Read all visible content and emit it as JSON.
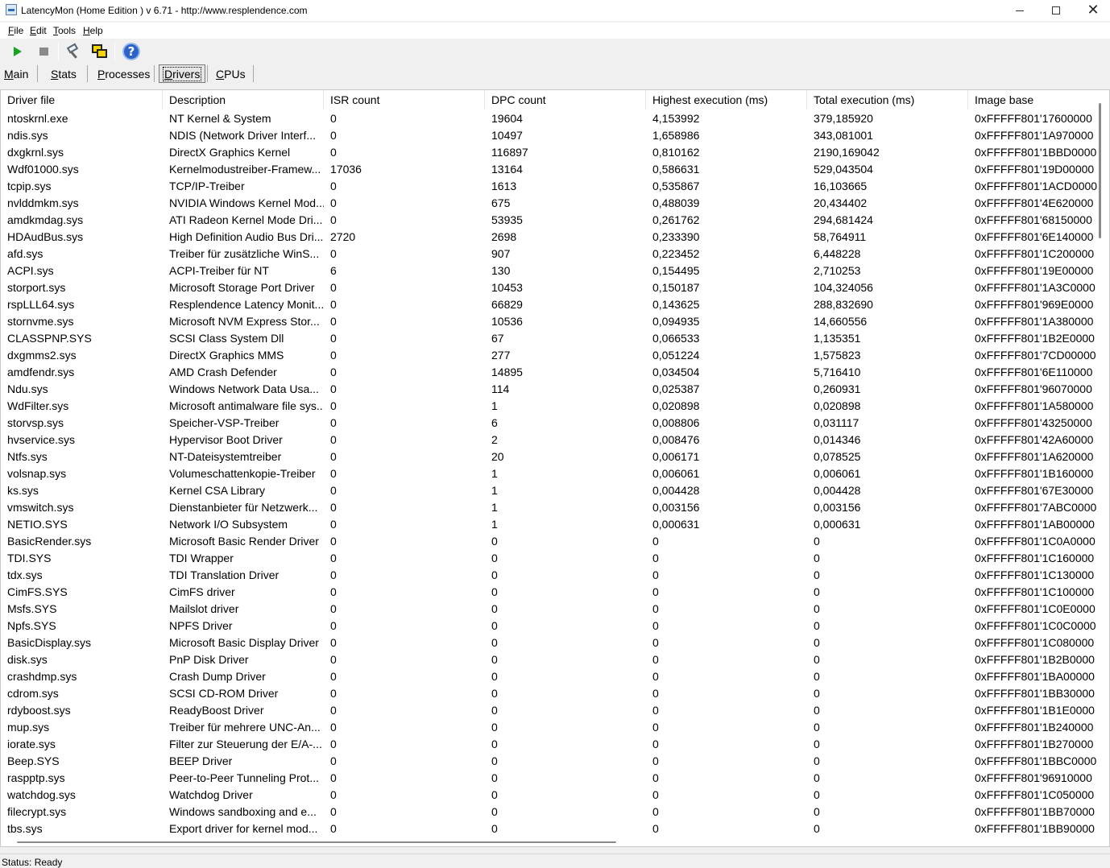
{
  "window": {
    "title": "LatencyMon  (Home Edition )  v 6.71 - http://www.resplendence.com"
  },
  "menu": [
    {
      "ul": "F",
      "rest": "ile"
    },
    {
      "ul": "E",
      "rest": "dit"
    },
    {
      "ul": "T",
      "rest": "ools"
    },
    {
      "ul": "H",
      "rest": "elp"
    }
  ],
  "toolbar": {
    "icons": [
      "play-icon",
      "stop-icon",
      "tools-icon",
      "windows-icon",
      "help-icon"
    ],
    "colors": {
      "play": "#17a31d",
      "help": "#2c63c8",
      "windows": "#f5d500"
    }
  },
  "tabs": [
    {
      "ul": "M",
      "rest": "ain"
    },
    {
      "ul": "S",
      "rest": "tats"
    },
    {
      "ul": "P",
      "rest": "rocesses"
    },
    {
      "ul": "D",
      "rest": "rivers"
    },
    {
      "ul": "C",
      "rest": "PUs"
    }
  ],
  "active_tab": "Drivers",
  "table": {
    "columns": [
      "Driver file",
      "Description",
      "ISR count",
      "DPC count",
      "Highest execution (ms)",
      "Total execution (ms)",
      "Image base"
    ],
    "rows": [
      [
        "ntoskrnl.exe",
        "NT Kernel & System",
        "0",
        "19604",
        "4,153992",
        "379,185920",
        "0xFFFFF801'17600000"
      ],
      [
        "ndis.sys",
        "NDIS (Network Driver Interf...",
        "0",
        "10497",
        "1,658986",
        "343,081001",
        "0xFFFFF801'1A970000"
      ],
      [
        "dxgkrnl.sys",
        "DirectX Graphics Kernel",
        "0",
        "116897",
        "0,810162",
        "2190,169042",
        "0xFFFFF801'1BBD0000"
      ],
      [
        "Wdf01000.sys",
        "Kernelmodustreiber-Framew...",
        "17036",
        "13164",
        "0,586631",
        "529,043504",
        "0xFFFFF801'19D00000"
      ],
      [
        "tcpip.sys",
        "TCP/IP-Treiber",
        "0",
        "1613",
        "0,535867",
        "16,103665",
        "0xFFFFF801'1ACD0000"
      ],
      [
        "nvlddmkm.sys",
        "NVIDIA Windows Kernel Mod...",
        "0",
        "675",
        "0,488039",
        "20,434402",
        "0xFFFFF801'4E620000"
      ],
      [
        "amdkmdag.sys",
        "ATI Radeon Kernel Mode Dri...",
        "0",
        "53935",
        "0,261762",
        "294,681424",
        "0xFFFFF801'68150000"
      ],
      [
        "HDAudBus.sys",
        "High Definition Audio Bus Dri...",
        "2720",
        "2698",
        "0,233390",
        "58,764911",
        "0xFFFFF801'6E140000"
      ],
      [
        "afd.sys",
        "Treiber für zusätzliche WinS...",
        "0",
        "907",
        "0,223452",
        "6,448228",
        "0xFFFFF801'1C200000"
      ],
      [
        "ACPI.sys",
        "ACPI-Treiber für NT",
        "6",
        "130",
        "0,154495",
        "2,710253",
        "0xFFFFF801'19E00000"
      ],
      [
        "storport.sys",
        "Microsoft Storage Port Driver",
        "0",
        "10453",
        "0,150187",
        "104,324056",
        "0xFFFFF801'1A3C0000"
      ],
      [
        "rspLLL64.sys",
        "Resplendence Latency Monit...",
        "0",
        "66829",
        "0,143625",
        "288,832690",
        "0xFFFFF801'969E0000"
      ],
      [
        "stornvme.sys",
        "Microsoft NVM Express Stor...",
        "0",
        "10536",
        "0,094935",
        "14,660556",
        "0xFFFFF801'1A380000"
      ],
      [
        "CLASSPNP.SYS",
        "SCSI Class System Dll",
        "0",
        "67",
        "0,066533",
        "1,135351",
        "0xFFFFF801'1B2E0000"
      ],
      [
        "dxgmms2.sys",
        "DirectX Graphics MMS",
        "0",
        "277",
        "0,051224",
        "1,575823",
        "0xFFFFF801'7CD00000"
      ],
      [
        "amdfendr.sys",
        "AMD Crash Defender",
        "0",
        "14895",
        "0,034504",
        "5,716410",
        "0xFFFFF801'6E110000"
      ],
      [
        "Ndu.sys",
        "Windows Network Data Usa...",
        "0",
        "114",
        "0,025387",
        "0,260931",
        "0xFFFFF801'96070000"
      ],
      [
        "WdFilter.sys",
        "Microsoft antimalware file sys...",
        "0",
        "1",
        "0,020898",
        "0,020898",
        "0xFFFFF801'1A580000"
      ],
      [
        "storvsp.sys",
        "Speicher-VSP-Treiber",
        "0",
        "6",
        "0,008806",
        "0,031117",
        "0xFFFFF801'43250000"
      ],
      [
        "hvservice.sys",
        "Hypervisor Boot Driver",
        "0",
        "2",
        "0,008476",
        "0,014346",
        "0xFFFFF801'42A60000"
      ],
      [
        "Ntfs.sys",
        "NT-Dateisystemtreiber",
        "0",
        "20",
        "0,006171",
        "0,078525",
        "0xFFFFF801'1A620000"
      ],
      [
        "volsnap.sys",
        "Volumeschattenkopie-Treiber",
        "0",
        "1",
        "0,006061",
        "0,006061",
        "0xFFFFF801'1B160000"
      ],
      [
        "ks.sys",
        "Kernel CSA Library",
        "0",
        "1",
        "0,004428",
        "0,004428",
        "0xFFFFF801'67E30000"
      ],
      [
        "vmswitch.sys",
        "Dienstanbieter für Netzwerk...",
        "0",
        "1",
        "0,003156",
        "0,003156",
        "0xFFFFF801'7ABC0000"
      ],
      [
        "NETIO.SYS",
        "Network I/O Subsystem",
        "0",
        "1",
        "0,000631",
        "0,000631",
        "0xFFFFF801'1AB00000"
      ],
      [
        "BasicRender.sys",
        "Microsoft Basic Render Driver",
        "0",
        "0",
        "0",
        "0",
        "0xFFFFF801'1C0A0000"
      ],
      [
        "TDI.SYS",
        "TDI Wrapper",
        "0",
        "0",
        "0",
        "0",
        "0xFFFFF801'1C160000"
      ],
      [
        "tdx.sys",
        "TDI Translation Driver",
        "0",
        "0",
        "0",
        "0",
        "0xFFFFF801'1C130000"
      ],
      [
        "CimFS.SYS",
        "CimFS driver",
        "0",
        "0",
        "0",
        "0",
        "0xFFFFF801'1C100000"
      ],
      [
        "Msfs.SYS",
        "Mailslot driver",
        "0",
        "0",
        "0",
        "0",
        "0xFFFFF801'1C0E0000"
      ],
      [
        "Npfs.SYS",
        "NPFS Driver",
        "0",
        "0",
        "0",
        "0",
        "0xFFFFF801'1C0C0000"
      ],
      [
        "BasicDisplay.sys",
        "Microsoft Basic Display Driver",
        "0",
        "0",
        "0",
        "0",
        "0xFFFFF801'1C080000"
      ],
      [
        "disk.sys",
        "PnP Disk Driver",
        "0",
        "0",
        "0",
        "0",
        "0xFFFFF801'1B2B0000"
      ],
      [
        "crashdmp.sys",
        "Crash Dump Driver",
        "0",
        "0",
        "0",
        "0",
        "0xFFFFF801'1BA00000"
      ],
      [
        "cdrom.sys",
        "SCSI CD-ROM Driver",
        "0",
        "0",
        "0",
        "0",
        "0xFFFFF801'1BB30000"
      ],
      [
        "rdyboost.sys",
        "ReadyBoost Driver",
        "0",
        "0",
        "0",
        "0",
        "0xFFFFF801'1B1E0000"
      ],
      [
        "mup.sys",
        "Treiber für mehrere UNC-An...",
        "0",
        "0",
        "0",
        "0",
        "0xFFFFF801'1B240000"
      ],
      [
        "iorate.sys",
        "Filter zur Steuerung der E/A-...",
        "0",
        "0",
        "0",
        "0",
        "0xFFFFF801'1B270000"
      ],
      [
        "Beep.SYS",
        "BEEP Driver",
        "0",
        "0",
        "0",
        "0",
        "0xFFFFF801'1BBC0000"
      ],
      [
        "raspptp.sys",
        "Peer-to-Peer Tunneling Prot...",
        "0",
        "0",
        "0",
        "0",
        "0xFFFFF801'96910000"
      ],
      [
        "watchdog.sys",
        "Watchdog Driver",
        "0",
        "0",
        "0",
        "0",
        "0xFFFFF801'1C050000"
      ],
      [
        "filecrypt.sys",
        "Windows sandboxing and e...",
        "0",
        "0",
        "0",
        "0",
        "0xFFFFF801'1BB70000"
      ],
      [
        "tbs.sys",
        "Export driver for kernel mod...",
        "0",
        "0",
        "0",
        "0",
        "0xFFFFF801'1BB90000"
      ]
    ]
  },
  "status": {
    "text": "Status: Ready"
  }
}
